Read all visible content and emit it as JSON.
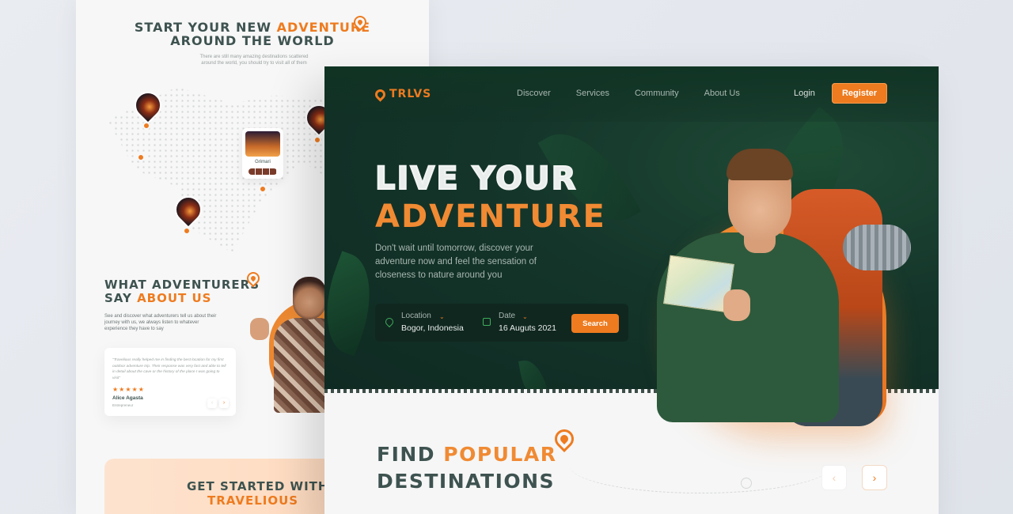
{
  "back": {
    "title_part1": "START YOUR NEW ",
    "title_accent": "ADVENTURE",
    "title_part2": "AROUND THE WORLD",
    "subtitle": "There are still many amazing destinations scattered around the world, you should try to visit all of them",
    "card_name": "Grimari",
    "testimonial_title_part1": "WHAT ADVENTURERS",
    "testimonial_title_part2": "SAY ",
    "testimonial_title_accent": "ABOUT US",
    "testimonial_desc": "See and discover what adventurers tell us about their journey with us, we always listen to whatever experience they have to say",
    "review_quote": "\"Travelious really helped me in finding the best location for my first outdoor adventure trip. Their response was very fast and able to tell in detail about the cave or the history of the place I was going to visit\"",
    "review_stars": "★★★★★",
    "reviewer_name": "Alice Agasta",
    "reviewer_role": "Entrepreneur",
    "start_title_part1": "GET STARTED WITH",
    "start_title_accent": "TRAVELIOUS"
  },
  "front": {
    "logo": "TRLVS",
    "nav": [
      "Discover",
      "Services",
      "Community",
      "About Us"
    ],
    "login": "Login",
    "register": "Register",
    "hero_line1": "LIVE YOUR",
    "hero_line2": "ADVENTURE",
    "hero_desc": "Don't wait until tomorrow, discover your adventure now and feel the sensation of closeness to nature around you",
    "search": {
      "location_label": "Location",
      "location_value": "Bogor, Indonesia",
      "date_label": "Date",
      "date_value": "16 Auguts 2021",
      "button": "Search"
    },
    "find_part1": "FIND ",
    "find_accent": "POPULAR",
    "find_part2": "DESTINATIONS",
    "prev_arrow": "‹",
    "next_arrow": "›"
  },
  "colors": {
    "accent": "#ee7b1f",
    "dark_green": "#14352a",
    "heading_slate": "#3e5350"
  }
}
